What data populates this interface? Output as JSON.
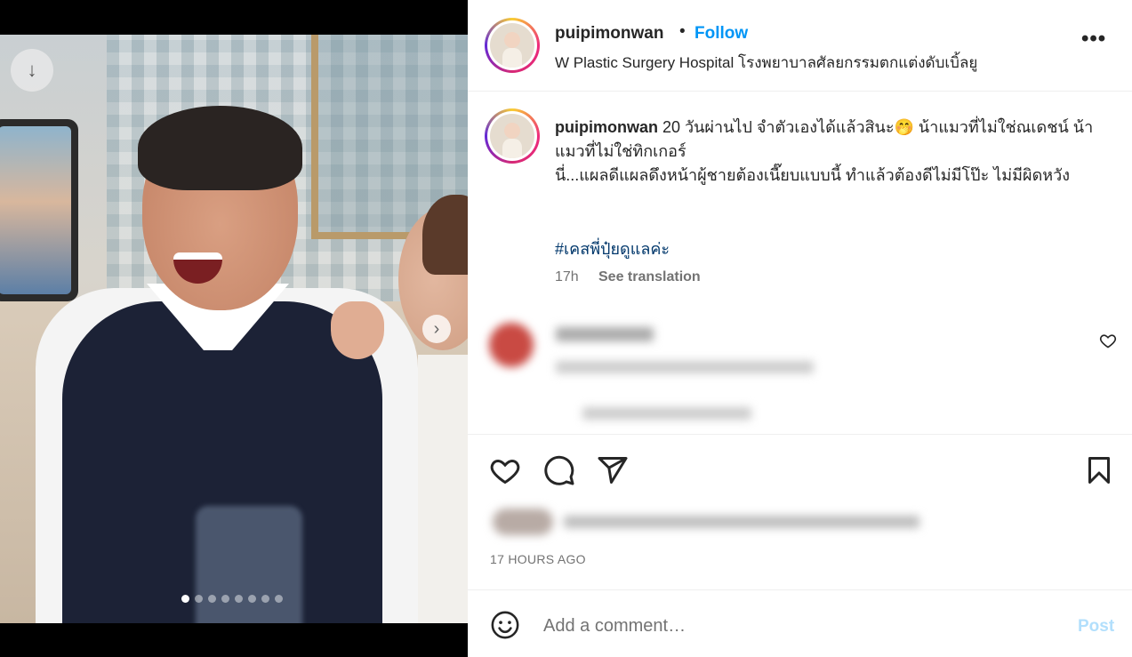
{
  "post": {
    "author": "puipimonwan",
    "separator": "•",
    "follow_label": "Follow",
    "location": "W Plastic Surgery Hospital โรงพยาบาลศัลยกรรมตกแต่งดับเบิ้ลยู",
    "more_label": "•••"
  },
  "caption": {
    "author": "puipimonwan",
    "line1": " 20 วันผ่านไป จำตัวเองได้แล้วสินะ🤭 น้าแมวที่ไม่ใช่ณเดชน์ น้าแมวที่ไม่ใช่ทิกเกอร์",
    "line2": "นี่...แผลดีแผลดึงหน้าผู้ชายต้องเนี๊ยบแบบนี้ ทำแล้วต้องดีไม่มีโป๊ะ ไม่มีผิดหวัง",
    "hashtag": "#เคสพี่ปุ๋ยดูแลค่ะ",
    "time": "17h",
    "see_translation": "See translation"
  },
  "media": {
    "slide_count": 8,
    "active_slide": 1,
    "download_icon": "↓",
    "next_icon": "›"
  },
  "footer": {
    "time_ago": "17 HOURS AGO",
    "comment_placeholder": "Add a comment…",
    "post_label": "Post"
  },
  "colors": {
    "accent": "#0095f6",
    "hashtag": "#00376b",
    "muted": "#737373",
    "post_disabled": "#b2dffc"
  }
}
